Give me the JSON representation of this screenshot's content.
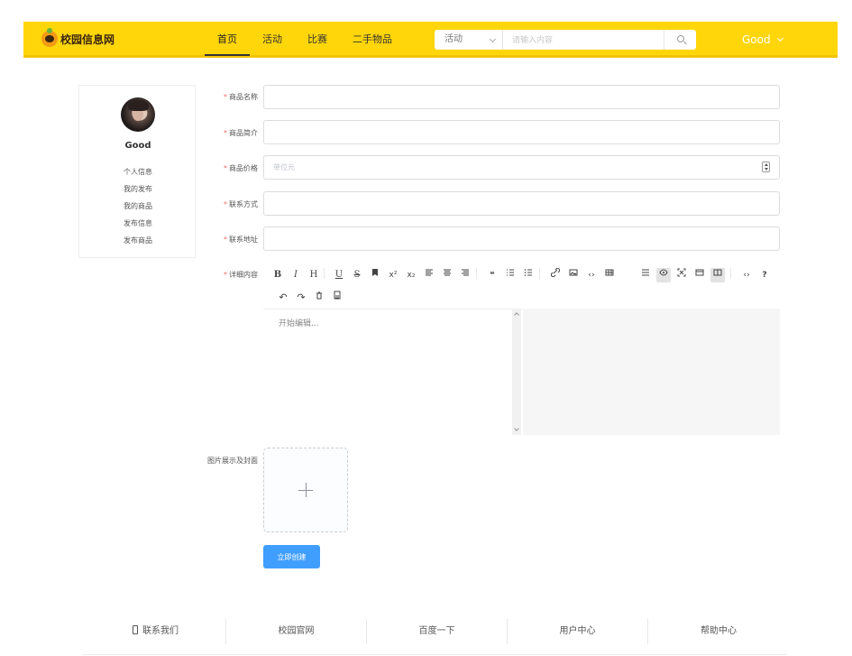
{
  "header": {
    "brand": "校园信息网",
    "nav": [
      "首页",
      "活动",
      "比赛",
      "二手物品"
    ],
    "search": {
      "category": "活动",
      "placeholder": "请输入内容"
    },
    "user": "Good"
  },
  "sidebar": {
    "name": "Good",
    "items": [
      "个人信息",
      "我的发布",
      "我的商品",
      "发布信息",
      "发布商品"
    ]
  },
  "form": {
    "required_mark": "*",
    "fields": [
      {
        "label": "商品名称",
        "value": ""
      },
      {
        "label": "商品简介",
        "value": ""
      },
      {
        "label": "商品价格",
        "placeholder": "单位元",
        "value": ""
      },
      {
        "label": "联系方式",
        "value": ""
      },
      {
        "label": "联系地址",
        "value": ""
      }
    ],
    "editor_label": "详细内容",
    "editor_placeholder": "开始编辑...",
    "upload_label": "图片展示及封面",
    "submit": "立即创建"
  },
  "toolbar": {
    "icons": [
      "bold-icon",
      "italic-icon",
      "header-icon",
      "underline-icon",
      "strikethrough-icon",
      "mark-icon",
      "superscript-icon",
      "subscript-icon",
      "align-left-icon",
      "align-center-icon",
      "align-right-icon",
      "quote-icon",
      "ordered-list-icon",
      "unordered-list-icon",
      "link-icon",
      "image-icon",
      "code-icon",
      "table-icon",
      "navigation-icon",
      "preview-icon",
      "fullscreen-icon",
      "read-mode-icon",
      "split-view-icon",
      "html-icon",
      "help-icon",
      "undo-icon",
      "redo-icon",
      "delete-icon",
      "save-icon"
    ],
    "glyphs": {
      "bold": "B",
      "italic": "I",
      "header": "H",
      "underline": "U",
      "strikethrough": "S",
      "superscript": "x²",
      "subscript": "x₂",
      "quote": "❝",
      "code": "‹›",
      "html": "‹›",
      "help": "?",
      "undo": "↶",
      "redo": "↷"
    }
  },
  "footer": {
    "items": [
      "联系我们",
      "校园官网",
      "百度一下",
      "用户中心",
      "帮助中心"
    ]
  },
  "colors": {
    "header": "#ffd60a",
    "primary": "#409eff",
    "required": "#f56c6c"
  }
}
